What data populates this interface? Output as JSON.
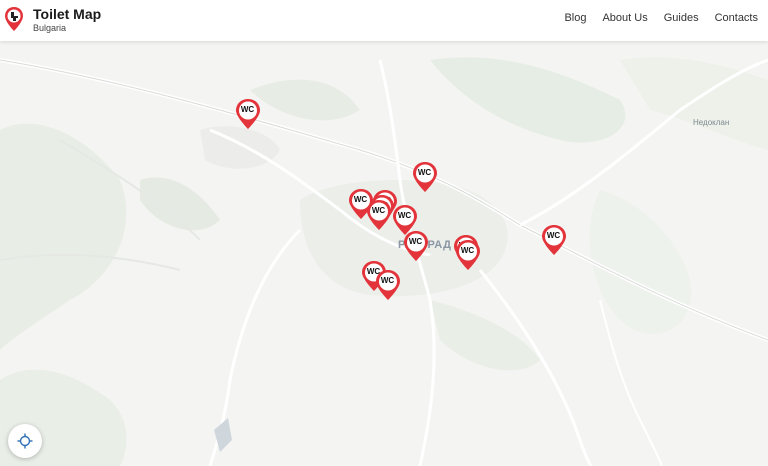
{
  "header": {
    "title": "Toilet Map",
    "subtitle": "Bulgaria",
    "logo_icon": "toilet-pin-icon",
    "nav": [
      "Blog",
      "About Us",
      "Guides",
      "Contacts"
    ]
  },
  "map": {
    "city_label": "РАЗГРАД",
    "village_label": "Недоклан",
    "marker_label": "WC",
    "marker_color": "#e2343a",
    "marker_count": 14,
    "locate_icon": "crosshair-icon"
  }
}
